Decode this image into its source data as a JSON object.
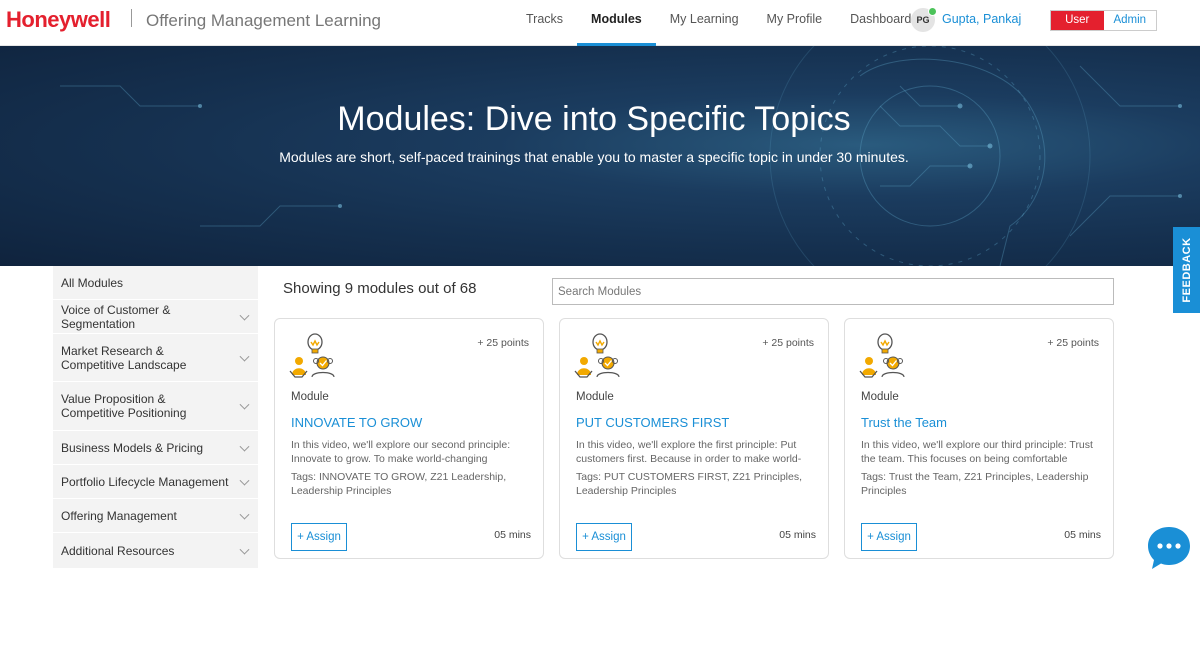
{
  "header": {
    "brand": "Honeywell",
    "app_title": "Offering Management Learning",
    "nav": [
      {
        "label": "Tracks",
        "active": false
      },
      {
        "label": "Modules",
        "active": true
      },
      {
        "label": "My Learning",
        "active": false
      },
      {
        "label": "My Profile",
        "active": false
      },
      {
        "label": "Dashboard",
        "active": false
      }
    ],
    "avatar_initials": "PG",
    "user_name": "Gupta, Pankaj",
    "role_user": "User",
    "role_admin": "Admin"
  },
  "hero": {
    "title": "Modules: Dive into Specific Topics",
    "subtitle": "Modules are short, self-paced trainings that enable you to master a specific topic in under 30 minutes."
  },
  "feedback_label": "FEEDBACK",
  "sidebar": {
    "items": [
      {
        "label": "All Modules",
        "expandable": false
      },
      {
        "label": "Voice of Customer & Segmentation",
        "expandable": true
      },
      {
        "label": "Market Research & Competitive Landscape",
        "expandable": true
      },
      {
        "label": "Value Proposition & Competitive Positioning",
        "expandable": true
      },
      {
        "label": "Business Models & Pricing",
        "expandable": true
      },
      {
        "label": "Portfolio Lifecycle Management",
        "expandable": true
      },
      {
        "label": "Offering Management",
        "expandable": true
      },
      {
        "label": "Additional Resources",
        "expandable": true
      }
    ]
  },
  "listing": {
    "showing_text": "Showing 9 modules out of 68",
    "search_placeholder": "Search Modules"
  },
  "cards": [
    {
      "points": "+ 25 points",
      "type": "Module",
      "title": "INNOVATE TO GROW",
      "description": "In this video, we'll explore our second principle: Innovate to grow. To make world-changing",
      "tags": "Tags: INNOVATE TO GROW, Z21 Leadership, Leadership Principles",
      "assign_label": "+ Assign",
      "duration": "05 mins"
    },
    {
      "points": "+ 25 points",
      "type": "Module",
      "title": "PUT CUSTOMERS FIRST",
      "description": "In this video, we'll explore the first principle: Put customers first. Because in order to make world-",
      "tags": "Tags: PUT CUSTOMERS FIRST, Z21 Principles, Leadership Principles",
      "assign_label": "+ Assign",
      "duration": "05 mins"
    },
    {
      "points": "+ 25 points",
      "type": "Module",
      "title": "Trust the Team",
      "description": "In this video, we'll explore our third principle: Trust the team. This focuses on being comfortable",
      "tags": "Tags: Trust the Team, Z21 Principles, Leadership Principles",
      "assign_label": "+ Assign",
      "duration": "05 mins"
    }
  ],
  "colors": {
    "brand_red": "#e4202e",
    "accent_blue": "#1a8fd6",
    "hero_dark": "#15304f"
  },
  "icons": {
    "card_icon": "lightbulb-people-icon",
    "chat": "chat-bubble-icon"
  }
}
